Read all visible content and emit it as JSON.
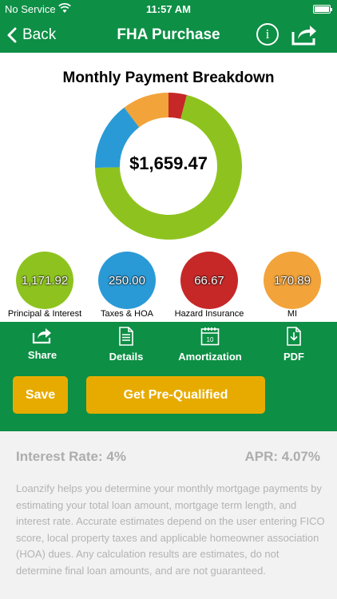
{
  "status_bar": {
    "carrier": "No Service",
    "time": "11:57 AM"
  },
  "nav": {
    "back_label": "Back",
    "title": "FHA Purchase",
    "info_label": "i"
  },
  "breakdown": {
    "title": "Monthly Payment Breakdown",
    "total": "$1,659.47",
    "items": [
      {
        "label": "Principal & Interest",
        "value": "1,171.92",
        "color": "#8ec31f"
      },
      {
        "label": "Taxes & HOA",
        "value": "250.00",
        "color": "#2a9ad6"
      },
      {
        "label": "Hazard Insurance",
        "value": "66.67",
        "color": "#c62828"
      },
      {
        "label": "MI",
        "value": "170.89",
        "color": "#f2a33a"
      }
    ]
  },
  "actions": {
    "share": "Share",
    "details": "Details",
    "amortization": "Amortization",
    "calendar_day": "10",
    "pdf": "PDF",
    "save": "Save",
    "prequalify": "Get Pre-Qualified"
  },
  "rates": {
    "interest": "Interest Rate: 4%",
    "apr": "APR: 4.07%"
  },
  "disclaimer": "Loanzify helps you determine your monthly mortgage payments by estimating your total loan amount, mortgage term length, and interest rate. Accurate estimates depend on the user entering FICO score, local property taxes and applicable homeowner association (HOA) dues. Any calculation results are estimates, do not determine final loan amounts, and are not guaranteed."
}
